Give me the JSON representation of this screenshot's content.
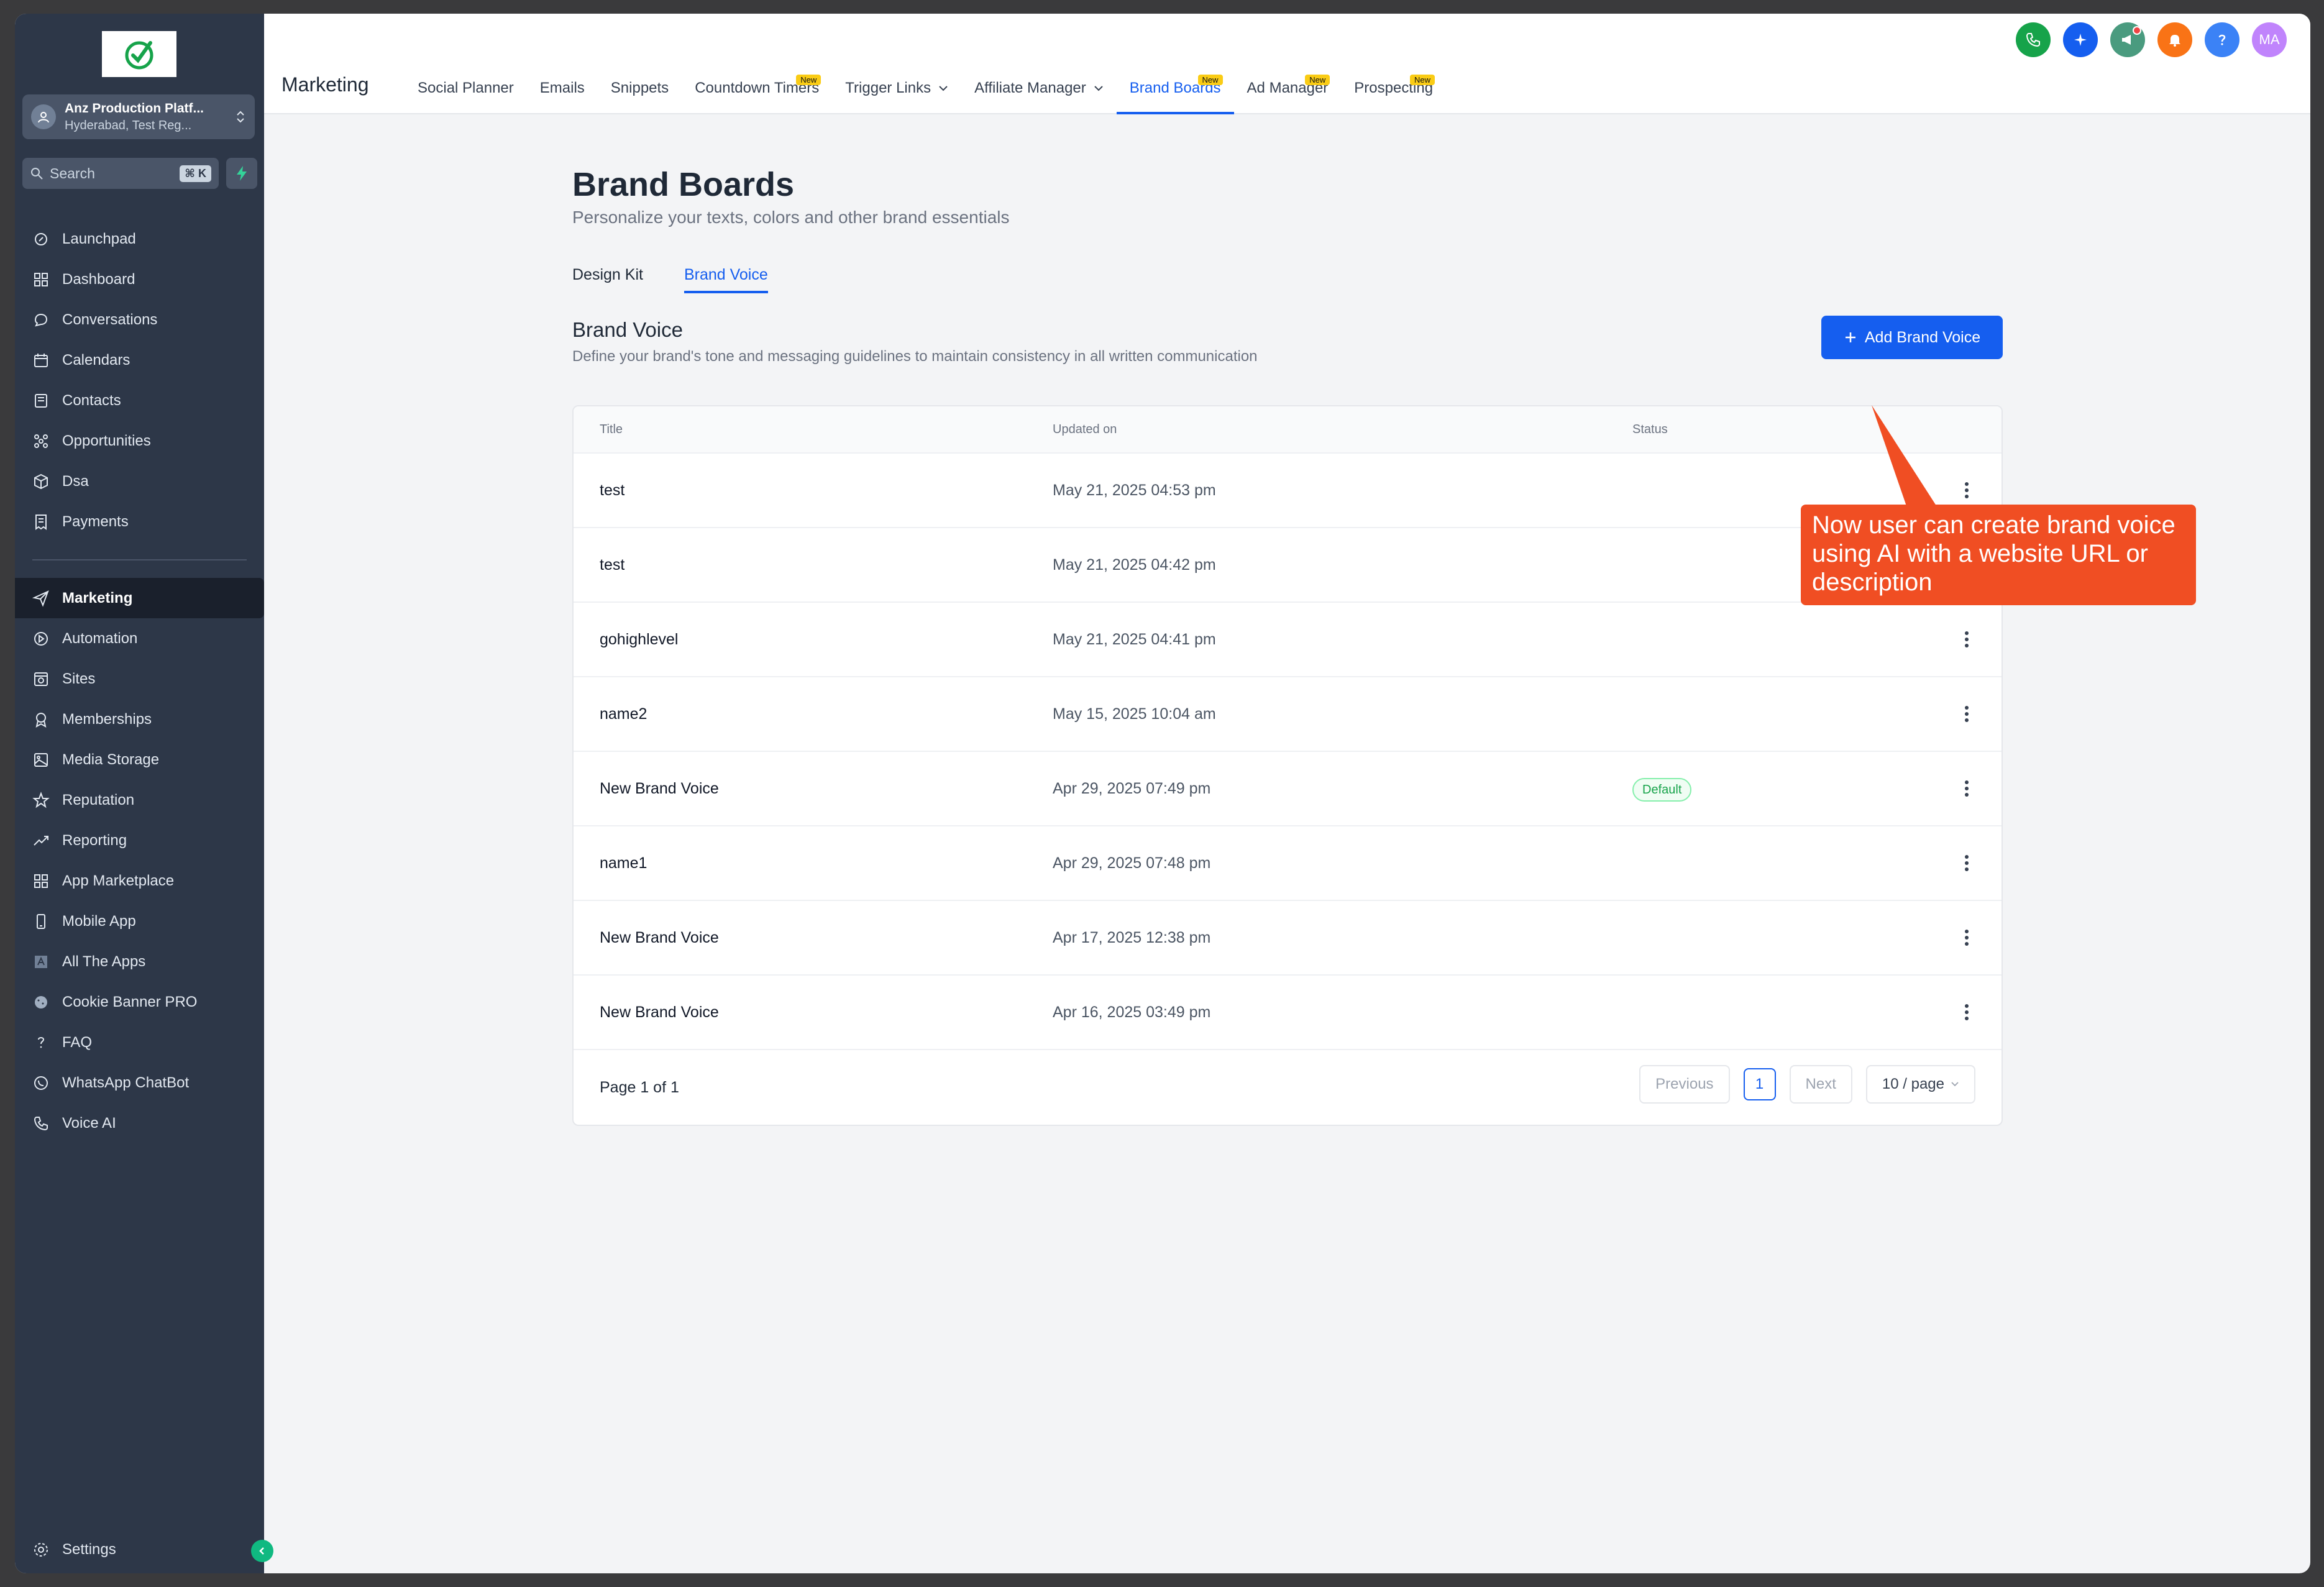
{
  "sidebar": {
    "account_name": "Anz Production Platf...",
    "account_location": "Hyderabad, Test Reg...",
    "search_placeholder": "Search",
    "search_shortcut": "⌘ K",
    "items": [
      {
        "label": "Launchpad",
        "icon": "rocket-icon"
      },
      {
        "label": "Dashboard",
        "icon": "grid-icon"
      },
      {
        "label": "Conversations",
        "icon": "chat-icon"
      },
      {
        "label": "Calendars",
        "icon": "calendar-icon"
      },
      {
        "label": "Contacts",
        "icon": "contacts-icon"
      },
      {
        "label": "Opportunities",
        "icon": "opportunities-icon"
      },
      {
        "label": "Dsa",
        "icon": "cube-icon"
      },
      {
        "label": "Payments",
        "icon": "receipt-icon"
      }
    ],
    "items2": [
      {
        "label": "Marketing",
        "icon": "send-icon",
        "active": true
      },
      {
        "label": "Automation",
        "icon": "automation-icon"
      },
      {
        "label": "Sites",
        "icon": "sites-icon"
      },
      {
        "label": "Memberships",
        "icon": "badge-icon"
      },
      {
        "label": "Media Storage",
        "icon": "image-icon"
      },
      {
        "label": "Reputation",
        "icon": "star-icon"
      },
      {
        "label": "Reporting",
        "icon": "trend-icon"
      },
      {
        "label": "App Marketplace",
        "icon": "apps-icon"
      },
      {
        "label": "Mobile App",
        "icon": "mobile-icon"
      },
      {
        "label": "All The Apps",
        "icon": "all-apps-icon"
      },
      {
        "label": "Cookie Banner PRO",
        "icon": "cookie-icon"
      },
      {
        "label": "FAQ",
        "icon": "question-icon"
      },
      {
        "label": "WhatsApp ChatBot",
        "icon": "whatsapp-icon"
      },
      {
        "label": "Voice AI",
        "icon": "phone-icon"
      }
    ],
    "settings_label": "Settings"
  },
  "topbar": {
    "section": "Marketing",
    "tabs": [
      {
        "label": "Social Planner"
      },
      {
        "label": "Emails"
      },
      {
        "label": "Snippets"
      },
      {
        "label": "Countdown Timers",
        "badge": "New"
      },
      {
        "label": "Trigger Links",
        "dropdown": true
      },
      {
        "label": "Affiliate Manager",
        "dropdown": true
      },
      {
        "label": "Brand Boards",
        "badge": "New",
        "active": true
      },
      {
        "label": "Ad Manager",
        "badge": "New"
      },
      {
        "label": "Prospecting",
        "badge": "New"
      }
    ],
    "avatar_initials": "MA"
  },
  "page": {
    "title": "Brand Boards",
    "subtitle": "Personalize your texts, colors and other brand essentials",
    "tabs": [
      "Design Kit",
      "Brand Voice"
    ],
    "active_tab": "Brand Voice",
    "section_title": "Brand Voice",
    "section_subtitle": "Define your brand's tone and messaging guidelines to maintain consistency in all written communication",
    "add_button": "Add Brand Voice"
  },
  "table": {
    "headers": {
      "title": "Title",
      "updated": "Updated on",
      "status": "Status"
    },
    "rows": [
      {
        "title": "test",
        "updated": "May 21, 2025 04:53 pm",
        "status": ""
      },
      {
        "title": "test",
        "updated": "May 21, 2025 04:42 pm",
        "status": ""
      },
      {
        "title": "gohighlevel",
        "updated": "May 21, 2025 04:41 pm",
        "status": ""
      },
      {
        "title": "name2",
        "updated": "May 15, 2025 10:04 am",
        "status": ""
      },
      {
        "title": "New Brand Voice",
        "updated": "Apr 29, 2025 07:49 pm",
        "status": "Default"
      },
      {
        "title": "name1",
        "updated": "Apr 29, 2025 07:48 pm",
        "status": ""
      },
      {
        "title": "New Brand Voice",
        "updated": "Apr 17, 2025 12:38 pm",
        "status": ""
      },
      {
        "title": "New Brand Voice",
        "updated": "Apr 16, 2025 03:49 pm",
        "status": ""
      }
    ],
    "page_info": "Page 1 of 1",
    "prev": "Previous",
    "current_page": "1",
    "next": "Next",
    "page_size": "10 / page"
  },
  "callout": {
    "text": "Now user can create brand voice using AI with a website URL or description"
  },
  "colors": {
    "sidebar_bg": "#2d3748",
    "accent": "#155eef",
    "callout": "#f04e23",
    "default_badge": "#16a34a"
  }
}
